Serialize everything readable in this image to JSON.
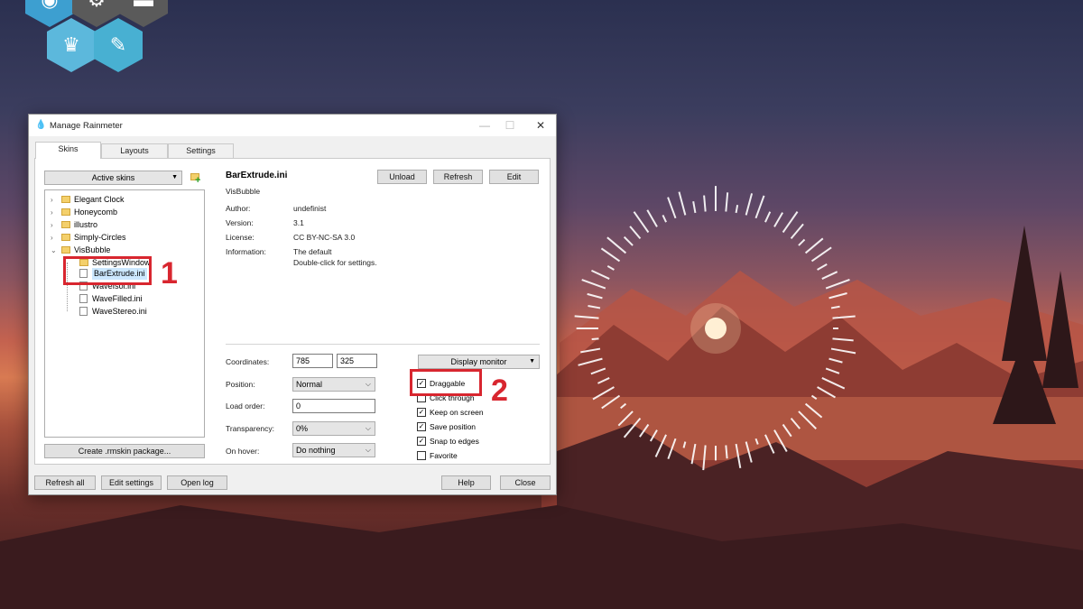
{
  "window": {
    "title": "Manage Rainmeter",
    "controls": {
      "minimize": "—",
      "maximize": "☐",
      "close": "✕"
    }
  },
  "tabs": [
    {
      "label": "Skins",
      "active": true
    },
    {
      "label": "Layouts",
      "active": false
    },
    {
      "label": "Settings",
      "active": false
    }
  ],
  "left": {
    "active_skins_label": "Active skins",
    "create_package_label": "Create .rmskin package...",
    "tree": [
      {
        "label": "Elegant Clock",
        "type": "folder",
        "expander": "›"
      },
      {
        "label": "Honeycomb",
        "type": "folder",
        "expander": "›"
      },
      {
        "label": "illustro",
        "type": "folder",
        "expander": "›"
      },
      {
        "label": "Simply-Circles",
        "type": "folder",
        "expander": "›"
      },
      {
        "label": "VisBubble",
        "type": "folder",
        "expander": "⌄"
      },
      {
        "label": "SettingsWindow",
        "type": "folder",
        "expander": ""
      },
      {
        "label": "BarExtrude.ini",
        "type": "file",
        "expander": "",
        "selected": true
      },
      {
        "label": "WaveIsol.ini",
        "type": "file",
        "expander": ""
      },
      {
        "label": "WaveFilled.ini",
        "type": "file",
        "expander": ""
      },
      {
        "label": "WaveStereo.ini",
        "type": "file",
        "expander": ""
      }
    ]
  },
  "skin": {
    "name": "BarExtrude.ini",
    "folder": "VisBubble",
    "buttons": {
      "unload": "Unload",
      "refresh": "Refresh",
      "edit": "Edit"
    },
    "meta": [
      {
        "label": "Author:",
        "value": "undefinist"
      },
      {
        "label": "Version:",
        "value": "3.1"
      },
      {
        "label": "License:",
        "value": "CC BY-NC-SA 3.0"
      },
      {
        "label": "Information:",
        "value": "The default",
        "value2": "Double-click for settings."
      }
    ]
  },
  "settings": {
    "coordinates_label": "Coordinates:",
    "coord_x": "785",
    "coord_y": "325",
    "position_label": "Position:",
    "position_value": "Normal",
    "load_order_label": "Load order:",
    "load_order_value": "0",
    "transparency_label": "Transparency:",
    "transparency_value": "0%",
    "on_hover_label": "On hover:",
    "on_hover_value": "Do nothing",
    "display_monitor_label": "Display monitor",
    "checkboxes": [
      {
        "label": "Draggable",
        "checked": true
      },
      {
        "label": "Click through",
        "checked": false
      },
      {
        "label": "Keep on screen",
        "checked": true
      },
      {
        "label": "Save position",
        "checked": true
      },
      {
        "label": "Snap to edges",
        "checked": true
      },
      {
        "label": "Favorite",
        "checked": false
      }
    ]
  },
  "footer": {
    "refresh_all": "Refresh all",
    "edit_settings": "Edit settings",
    "open_log": "Open log",
    "help": "Help",
    "close": "Close"
  },
  "annotations": {
    "one": "1",
    "two": "2"
  },
  "colors": {
    "annotation_red": "#d8262f",
    "selection_blue": "#cce8ff"
  }
}
